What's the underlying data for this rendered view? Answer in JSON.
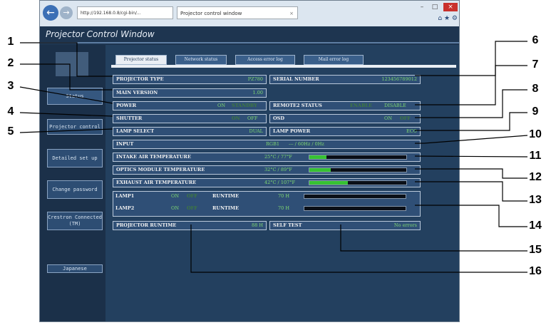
{
  "browser": {
    "url": "http://192.168.0.8/cgi-bin/...",
    "tab_title": "Projector control window",
    "tab_close": "×",
    "back": "←",
    "forward": "→",
    "window_min": "–",
    "window_max": "□",
    "window_close": "×",
    "toolbar_icons": "⌂ ★ ⚙"
  },
  "page": {
    "title": "Projector Control Window"
  },
  "sidebar": {
    "items": [
      {
        "label": "Status"
      },
      {
        "label": "Projector control"
      },
      {
        "label": "Detailed set up"
      },
      {
        "label": "Change password"
      },
      {
        "label": "Crestron Connected (TM)"
      },
      {
        "label": "Japanese"
      }
    ]
  },
  "tabs": [
    {
      "label": "Projector status"
    },
    {
      "label": "Network status"
    },
    {
      "label": "Access error log"
    },
    {
      "label": "Mail error log"
    }
  ],
  "status": {
    "projector_type": {
      "label": "PROJECTOR TYPE",
      "value": "PZ780"
    },
    "serial_number": {
      "label": "SERIAL NUMBER",
      "value": "123456789012"
    },
    "main_version": {
      "label": "MAIN VERSION",
      "value": "1.00"
    },
    "power": {
      "label": "POWER",
      "on": "ON",
      "standby": "STANDBY"
    },
    "remote2": {
      "label": "REMOTE2 STATUS",
      "enable": "ENABLE",
      "disable": "DISABLE"
    },
    "shutter": {
      "label": "SHUTTER",
      "on": "ON",
      "off": "OFF"
    },
    "osd": {
      "label": "OSD",
      "on": "ON",
      "off": "OFF"
    },
    "lamp_select": {
      "label": "LAMP SELECT",
      "value": "DUAL"
    },
    "lamp_power": {
      "label": "LAMP POWER",
      "value": "ECO"
    },
    "input": {
      "label": "INPUT",
      "value": "RGB1",
      "signal": "--- / 60Hz / 0Hz"
    },
    "intake": {
      "label": "INTAKE AIR TEMPERATURE",
      "value": "25°C / 77°F",
      "level": 0.18
    },
    "optics": {
      "label": "OPTICS MODULE TEMPERATURE",
      "value": "32°C / 89°F",
      "level": 0.22
    },
    "exhaust": {
      "label": "EXHAUST AIR TEMPERATURE",
      "value": "42°C / 107°F",
      "level": 0.4
    },
    "lamp1": {
      "label": "LAMP1",
      "on": "ON",
      "off": "OFF",
      "runtime_label": "RUNTIME",
      "runtime": "70 H",
      "level": 0.0
    },
    "lamp2": {
      "label": "LAMP2",
      "on": "ON",
      "off": "OFF",
      "runtime_label": "RUNTIME",
      "runtime": "70 H",
      "level": 0.0
    },
    "projector_runtime": {
      "label": "PROJECTOR RUNTIME",
      "value": "88 H"
    },
    "self_test": {
      "label": "SELF TEST",
      "value": "No errors"
    }
  },
  "callouts": [
    "1",
    "2",
    "3",
    "4",
    "5",
    "6",
    "7",
    "8",
    "9",
    "10",
    "11",
    "12",
    "13",
    "14",
    "15",
    "16"
  ],
  "colors": {
    "value_green": "#7fd870",
    "bar_green": "#37c233",
    "panel_blue": "#23405f"
  }
}
